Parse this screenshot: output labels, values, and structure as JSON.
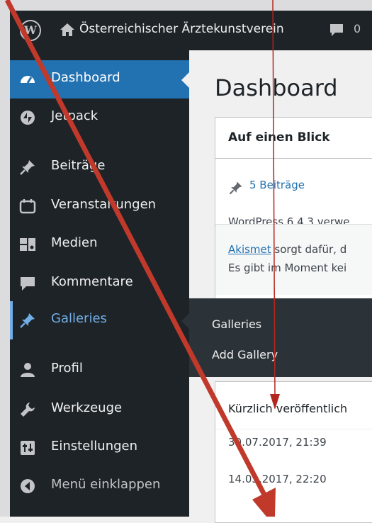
{
  "adminbar": {
    "site_name": "Österreichischer Ärztekunstverein",
    "comment_count": "0"
  },
  "sidebar": {
    "items": [
      {
        "label": "Dashboard",
        "icon": "dashboard-icon"
      },
      {
        "label": "Jetpack",
        "icon": "jetpack-icon"
      },
      {
        "label": "Beiträge",
        "icon": "pin-icon"
      },
      {
        "label": "Veranstaltungen",
        "icon": "calendar-icon"
      },
      {
        "label": "Medien",
        "icon": "media-icon"
      },
      {
        "label": "Kommentare",
        "icon": "comment-icon"
      },
      {
        "label": "Galleries",
        "icon": "pin-icon"
      },
      {
        "label": "Profil",
        "icon": "user-icon"
      },
      {
        "label": "Werkzeuge",
        "icon": "wrench-icon"
      },
      {
        "label": "Einstellungen",
        "icon": "settings-icon"
      },
      {
        "label": "Menü einklappen",
        "icon": "collapse-icon"
      }
    ]
  },
  "flyout": {
    "items": [
      "Galleries",
      "Add Gallery"
    ]
  },
  "main": {
    "title": "Dashboard",
    "glance": {
      "title": "Auf einen Blick",
      "posts_link": "5 Beiträge",
      "version_text": "WordPress 6.4.3 verwe",
      "akismet_link": "Akismet",
      "akismet_text": " sorgt dafür, d",
      "akismet_line2": "Es gibt im Moment kei"
    },
    "activity": {
      "title": "Kürzlich veröffentlich",
      "rows": [
        "30.07.2017, 21:39",
        "14.03.2017, 22:20"
      ]
    }
  },
  "colors": {
    "admin_bar": "#1d2327",
    "accent": "#2271b1",
    "submenu_active": "#72aee6",
    "annotation_red": "#c0392b",
    "annotation_thin": "#b3261e"
  }
}
